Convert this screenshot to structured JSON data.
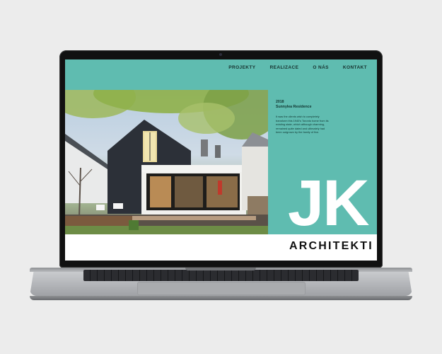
{
  "nav": {
    "items": [
      "PROJEKTY",
      "REALIZACE",
      "O NÁS",
      "KONTAKT"
    ]
  },
  "project": {
    "year": "2018",
    "title": "Sunnylea Residence",
    "description": "It was the clients wish to completely transform this 1940's Toronto home from its existing state, which although charming, remained quite dated and ultimately had been outgrown by the family of five."
  },
  "logo": {
    "initials": "JK",
    "name": "ARCHITEKTI"
  },
  "colors": {
    "accent": "#5fbcb0",
    "text_dark": "#103631",
    "white": "#ffffff"
  },
  "icons": [
    "camera-icon"
  ]
}
